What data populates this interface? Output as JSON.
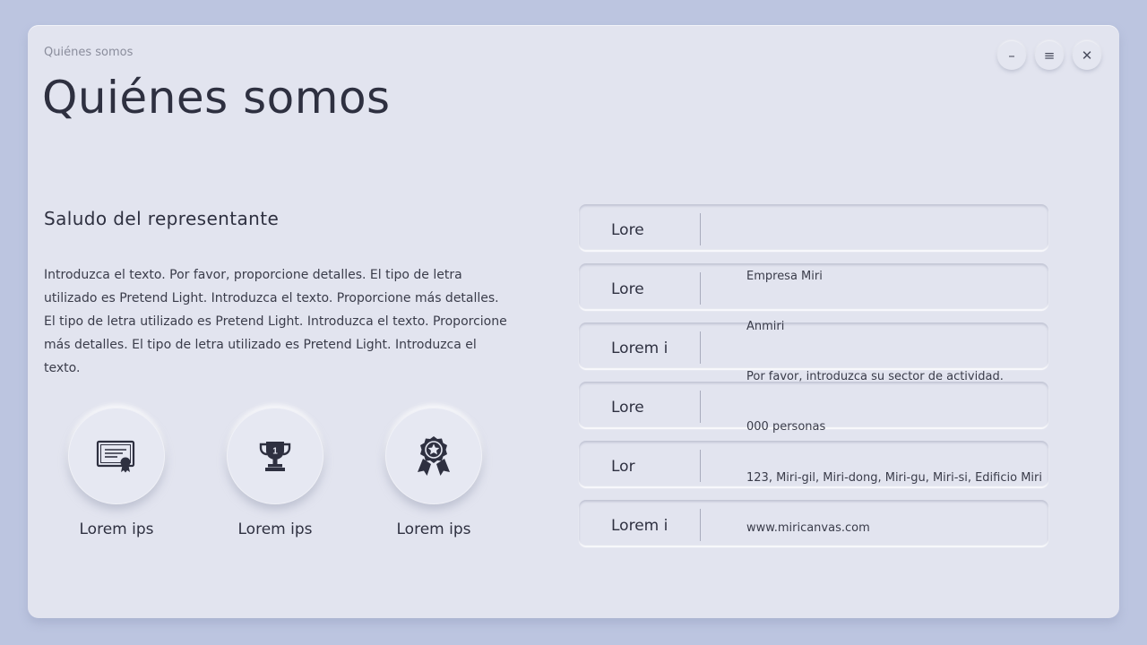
{
  "window": {
    "controls": [
      {
        "name": "minimize",
        "glyph": "–"
      },
      {
        "name": "menu",
        "glyph": "≡"
      },
      {
        "name": "close",
        "glyph": "✕"
      }
    ]
  },
  "header": {
    "breadcrumb": "Quiénes somos",
    "title": "Quiénes somos"
  },
  "greeting": {
    "heading": "Saludo del representante",
    "body": "Introduzca el texto. Por favor, proporcione detalles. El tipo de letra utilizado es Pretend Light. Introduzca el texto. Proporcione más detalles. El tipo de letra utilizado es Pretend Light. Introduzca el texto. Proporcione más detalles. El tipo de letra utilizado es Pretend Light. Introduzca el texto."
  },
  "badges": [
    {
      "icon": "certificate-icon",
      "label": "Lorem ips"
    },
    {
      "icon": "trophy-icon",
      "label": "Lorem ips"
    },
    {
      "icon": "award-ribbon-icon",
      "label": "Lorem ips"
    }
  ],
  "info_table": {
    "keys": [
      "Lore",
      "Lore",
      "Lorem i",
      "Lore",
      "Lor",
      "Lorem i"
    ],
    "values": [
      "Empresa Miri",
      "Anmiri",
      "Por favor, introduzca su sector de actividad.",
      "000 personas",
      "123, Miri-gil, Miri-dong, Miri-gu, Miri-si, Edificio Miri",
      "www.miricanvas.com"
    ]
  },
  "colors": {
    "background": "#bcc5e0",
    "panel": "#e2e4ef",
    "text": "#2e3040"
  }
}
